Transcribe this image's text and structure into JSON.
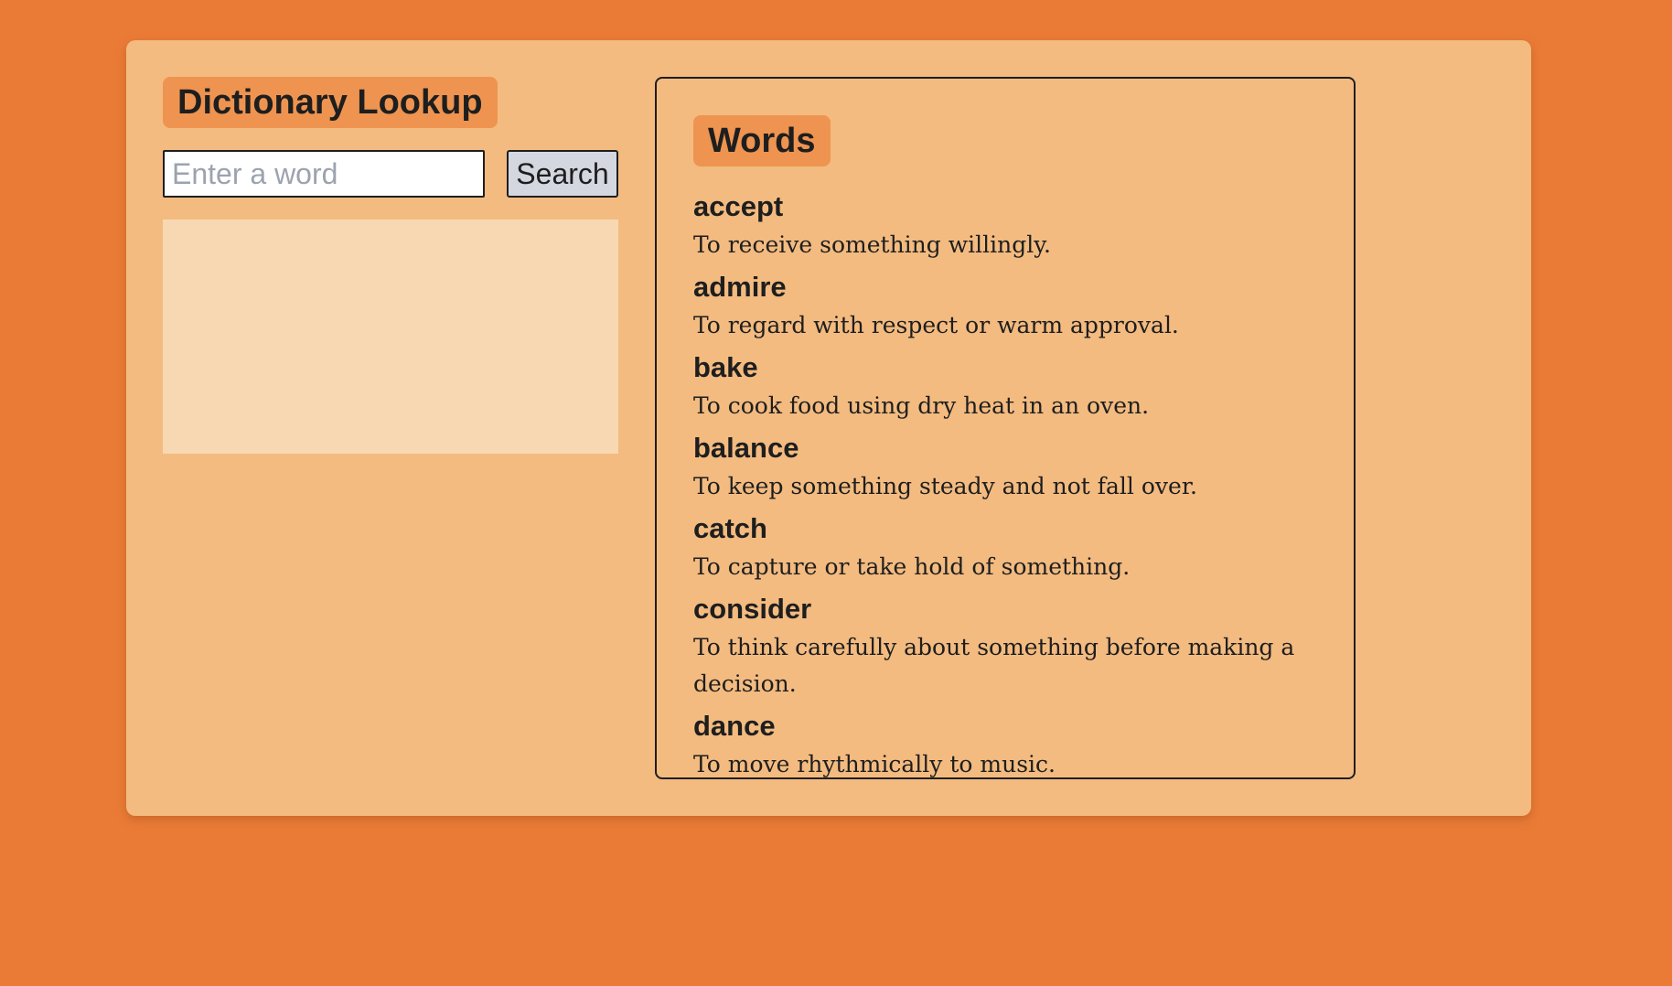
{
  "lookup": {
    "title": "Dictionary Lookup",
    "search_placeholder": "Enter a word",
    "search_value": "",
    "search_button_label": "Search"
  },
  "words_panel": {
    "title": "Words",
    "entries": [
      {
        "word": "accept",
        "definition": "To receive something willingly."
      },
      {
        "word": "admire",
        "definition": "To regard with respect or warm approval."
      },
      {
        "word": "bake",
        "definition": "To cook food using dry heat in an oven."
      },
      {
        "word": "balance",
        "definition": "To keep something steady and not fall over."
      },
      {
        "word": "catch",
        "definition": "To capture or take hold of something."
      },
      {
        "word": "consider",
        "definition": "To think carefully about something before making a decision."
      },
      {
        "word": "dance",
        "definition": "To move rhythmically to music."
      }
    ]
  },
  "colors": {
    "page_background": "#e97b36",
    "card_background": "#f3bb80",
    "badge_background": "#ee9450",
    "result_background": "#f7d8b2",
    "button_background": "#d4d7e0"
  }
}
